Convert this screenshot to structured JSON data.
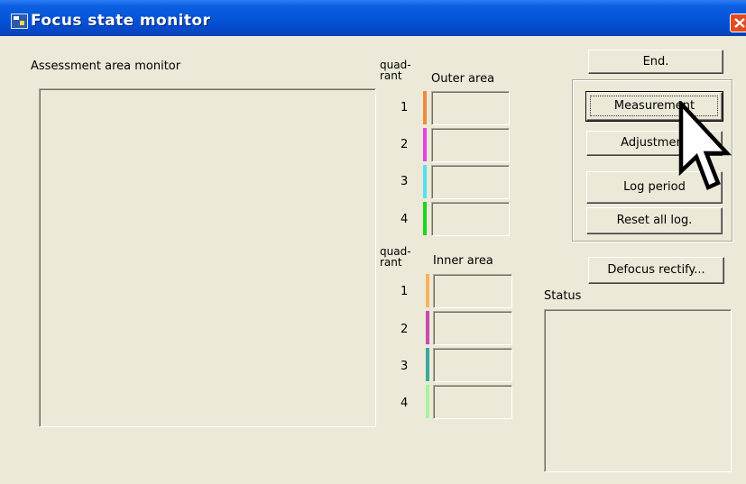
{
  "window": {
    "title": "Focus state monitor"
  },
  "assessment": {
    "title": "Assessment area monitor"
  },
  "outer": {
    "quad_label_top": "quad-",
    "quad_label_bottom": "rant",
    "area_label": "Outer area",
    "rows": [
      {
        "num": "1",
        "color": "#f28a3c"
      },
      {
        "num": "2",
        "color": "#e83fe6"
      },
      {
        "num": "3",
        "color": "#52e2f2"
      },
      {
        "num": "4",
        "color": "#19d81c"
      }
    ]
  },
  "inner": {
    "quad_label_top": "quad-",
    "quad_label_bottom": "rant",
    "area_label": "Inner area",
    "rows": [
      {
        "num": "1",
        "color": "#f7b35b"
      },
      {
        "num": "2",
        "color": "#c94ab0"
      },
      {
        "num": "3",
        "color": "#3aa89a"
      },
      {
        "num": "4",
        "color": "#a8f2a0"
      }
    ]
  },
  "buttons": {
    "end": "End.",
    "measurement": "Measurement",
    "adjustment": "Adjustment",
    "log_period": "Log period",
    "reset_all_log": "Reset all log.",
    "defocus_rectify": "Defocus rectify..."
  },
  "status": {
    "label": "Status"
  }
}
